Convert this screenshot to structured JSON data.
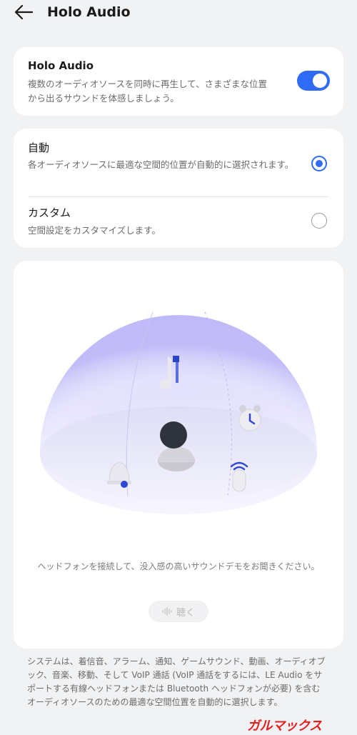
{
  "header": {
    "title": "Holo Audio",
    "back_icon": "arrow-left-icon"
  },
  "holo_card": {
    "title": "Holo Audio",
    "description": "複数のオーディオソースを同時に再生して、さまざまな位置から出るサウンドを体感しましょう。",
    "toggle_on": true,
    "accent": "#2f6cf6"
  },
  "mode_card": {
    "auto": {
      "title": "自動",
      "description": "各オーディオソースに最適な空間的位置が自動的に選択されます。",
      "selected": true
    },
    "custom": {
      "title": "カスタム",
      "description": "空間設定をカスタマイズします。",
      "selected": false
    }
  },
  "demo_card": {
    "illustration_icons": [
      "music-note-icon",
      "alarm-clock-icon",
      "bell-icon",
      "microphone-icon",
      "person-icon"
    ],
    "prompt": "ヘッドフォンを接続して、没入感の高いサウンドデモをお聞きください。",
    "listen_label": "聴く",
    "listen_icon": "sound-wave-icon"
  },
  "footer": {
    "text": "システムは、着信音、アラーム、通知、ゲームサウンド、動画、オーディオブック、音楽、移動、そして VoIP 通話 (VoIP 通話をするには、LE Audio をサポートする有線ヘッドフォンまたは Bluetooth ヘッドフォンが必要) を含むオーディオソースのための最適な空間位置を自動的に選択します。"
  },
  "watermark": {
    "text": "ガルマックス"
  }
}
